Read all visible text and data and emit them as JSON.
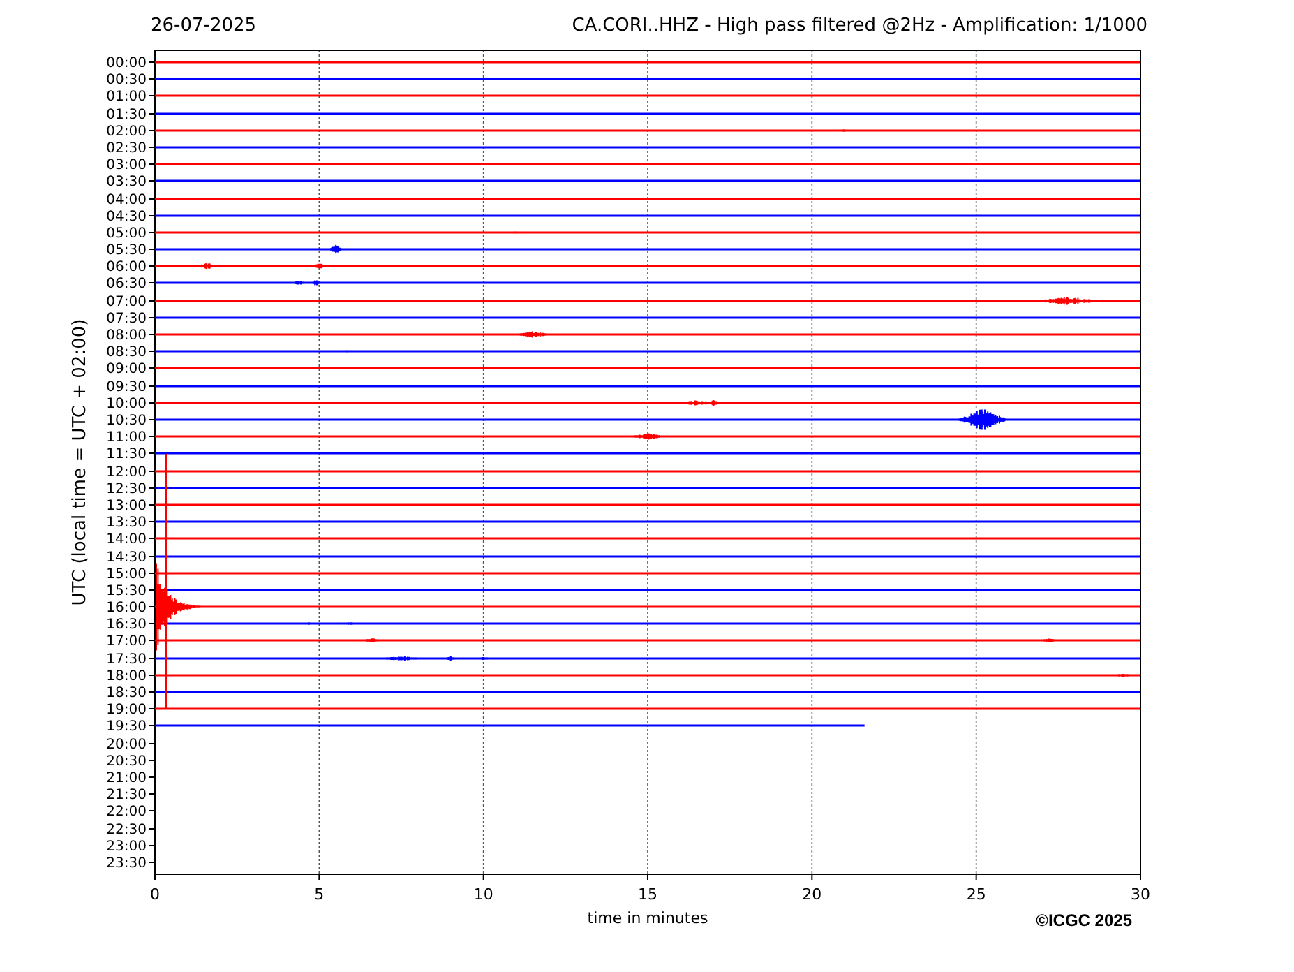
{
  "header": {
    "date": "26-07-2025",
    "title": "CA.CORI..HHZ - High pass filtered @2Hz - Amplification: 1/1000"
  },
  "plot": {
    "ylabel": "UTC (local time = UTC + 02:00)",
    "xlabel": "time in minutes",
    "xticks": [
      "0",
      "5",
      "10",
      "15",
      "20",
      "25",
      "30"
    ],
    "rows": [
      {
        "label": "00:00",
        "color": "#ff0000"
      },
      {
        "label": "00:30",
        "color": "#0000ff"
      },
      {
        "label": "01:00",
        "color": "#ff0000"
      },
      {
        "label": "01:30",
        "color": "#0000ff"
      },
      {
        "label": "02:00",
        "color": "#ff0000"
      },
      {
        "label": "02:30",
        "color": "#0000ff"
      },
      {
        "label": "03:00",
        "color": "#ff0000"
      },
      {
        "label": "03:30",
        "color": "#0000ff"
      },
      {
        "label": "04:00",
        "color": "#ff0000"
      },
      {
        "label": "04:30",
        "color": "#0000ff"
      },
      {
        "label": "05:00",
        "color": "#ff0000"
      },
      {
        "label": "05:30",
        "color": "#0000ff"
      },
      {
        "label": "06:00",
        "color": "#ff0000"
      },
      {
        "label": "06:30",
        "color": "#0000ff"
      },
      {
        "label": "07:00",
        "color": "#ff0000"
      },
      {
        "label": "07:30",
        "color": "#0000ff"
      },
      {
        "label": "08:00",
        "color": "#ff0000"
      },
      {
        "label": "08:30",
        "color": "#0000ff"
      },
      {
        "label": "09:00",
        "color": "#ff0000"
      },
      {
        "label": "09:30",
        "color": "#0000ff"
      },
      {
        "label": "10:00",
        "color": "#ff0000"
      },
      {
        "label": "10:30",
        "color": "#0000ff"
      },
      {
        "label": "11:00",
        "color": "#ff0000"
      },
      {
        "label": "11:30",
        "color": "#0000ff"
      },
      {
        "label": "12:00",
        "color": "#ff0000"
      },
      {
        "label": "12:30",
        "color": "#0000ff"
      },
      {
        "label": "13:00",
        "color": "#ff0000"
      },
      {
        "label": "13:30",
        "color": "#0000ff"
      },
      {
        "label": "14:00",
        "color": "#ff0000"
      },
      {
        "label": "14:30",
        "color": "#0000ff"
      },
      {
        "label": "15:00",
        "color": "#ff0000"
      },
      {
        "label": "15:30",
        "color": "#0000ff"
      },
      {
        "label": "16:00",
        "color": "#ff0000"
      },
      {
        "label": "16:30",
        "color": "#0000ff"
      },
      {
        "label": "17:00",
        "color": "#ff0000"
      },
      {
        "label": "17:30",
        "color": "#0000ff"
      },
      {
        "label": "18:00",
        "color": "#ff0000"
      },
      {
        "label": "18:30",
        "color": "#0000ff"
      },
      {
        "label": "19:00",
        "color": "#ff0000"
      },
      {
        "label": "19:30",
        "color": "#0000ff",
        "level": 0.72
      },
      {
        "label": "20:00"
      },
      {
        "label": "20:30"
      },
      {
        "label": "21:00"
      },
      {
        "label": "21:30"
      },
      {
        "label": "22:00"
      },
      {
        "label": "22:30"
      },
      {
        "label": "23:00"
      },
      {
        "label": "23:30"
      }
    ]
  },
  "copyright": "©ICGC 2025"
}
